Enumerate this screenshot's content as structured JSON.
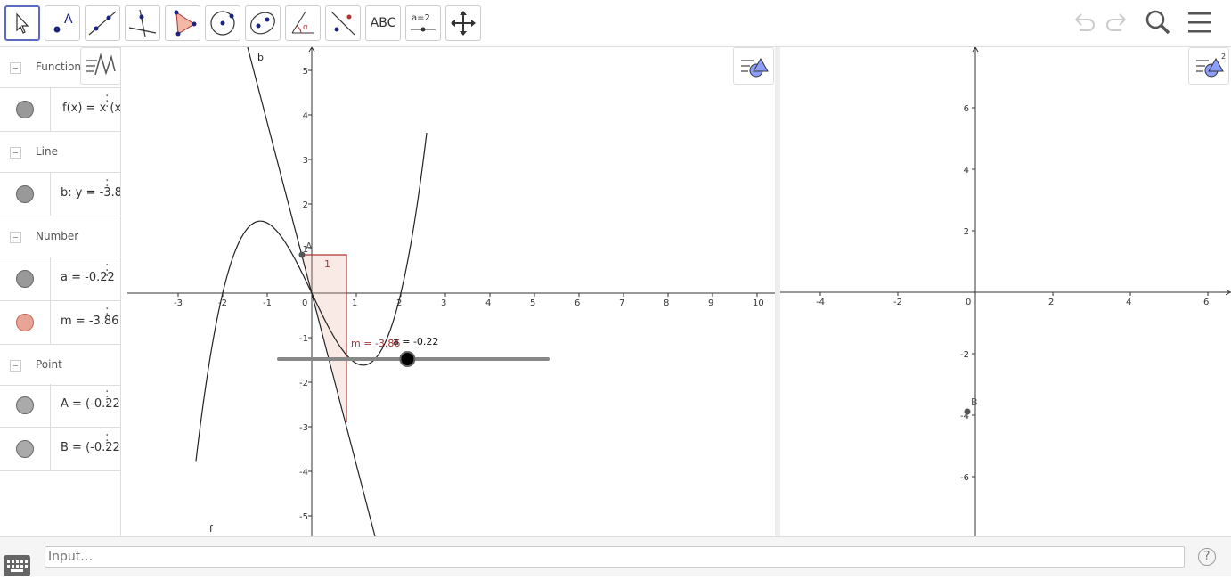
{
  "toolbar": {
    "tools": [
      {
        "id": "move",
        "icon": "arrow-cursor-icon"
      },
      {
        "id": "point",
        "icon": "point-icon",
        "label": "A"
      },
      {
        "id": "line",
        "icon": "line-icon"
      },
      {
        "id": "perpendicular",
        "icon": "perpendicular-line-icon"
      },
      {
        "id": "polygon",
        "icon": "polygon-icon"
      },
      {
        "id": "circle",
        "icon": "circle-icon"
      },
      {
        "id": "ellipse",
        "icon": "ellipse-icon"
      },
      {
        "id": "angle",
        "icon": "angle-icon",
        "label": "α"
      },
      {
        "id": "reflect",
        "icon": "reflect-icon"
      },
      {
        "id": "text",
        "icon": "text-icon",
        "label": "ABC"
      },
      {
        "id": "slider",
        "icon": "slider-icon",
        "label": "a=2"
      },
      {
        "id": "move-view",
        "icon": "move-graphics-icon"
      }
    ],
    "undo_icon": "undo-icon",
    "redo_icon": "redo-icon",
    "search_icon": "search-icon",
    "menu_icon": "hamburger-menu-icon"
  },
  "algebra": {
    "groups": [
      {
        "title": "Function",
        "items": [
          {
            "expr": "f(x) = x (x",
            "color": "#808080"
          }
        ]
      },
      {
        "title": "Line",
        "items": [
          {
            "expr": "b: y = -3.8",
            "color": "#808080"
          }
        ]
      },
      {
        "title": "Number",
        "items": [
          {
            "expr": "a = -0.22",
            "color": "#808080"
          },
          {
            "expr": "m = -3.86",
            "color": "#e8a595"
          }
        ]
      },
      {
        "title": "Point",
        "items": [
          {
            "expr": "A = (-0.22,",
            "color": "#9e9e9e"
          },
          {
            "expr": "B = (-0.22,",
            "color": "#9e9e9e"
          }
        ]
      }
    ]
  },
  "graphics1": {
    "x_ticks": [
      "-3",
      "-2",
      "-1",
      "0",
      "1",
      "2",
      "3",
      "4",
      "5",
      "6",
      "7",
      "8",
      "9",
      "10"
    ],
    "y_ticks": [
      "5",
      "4",
      "3",
      "2",
      "1",
      "-1",
      "-2",
      "-3",
      "-4",
      "-5"
    ],
    "labels": {
      "b": "b",
      "f": "f",
      "A": "A",
      "slope_num": "1",
      "m_label": "m = -3.86",
      "a_label": "a = -0.22"
    },
    "slider_value": -0.22,
    "slider_min": -5,
    "slider_max": 5
  },
  "graphics2": {
    "x_ticks": [
      "-4",
      "-2",
      "0",
      "2",
      "4",
      "6"
    ],
    "y_ticks": [
      "6",
      "4",
      "2",
      "-2",
      "-4",
      "-6"
    ],
    "point_label": "B"
  },
  "input": {
    "placeholder": "Input…"
  },
  "help_label": "?"
}
